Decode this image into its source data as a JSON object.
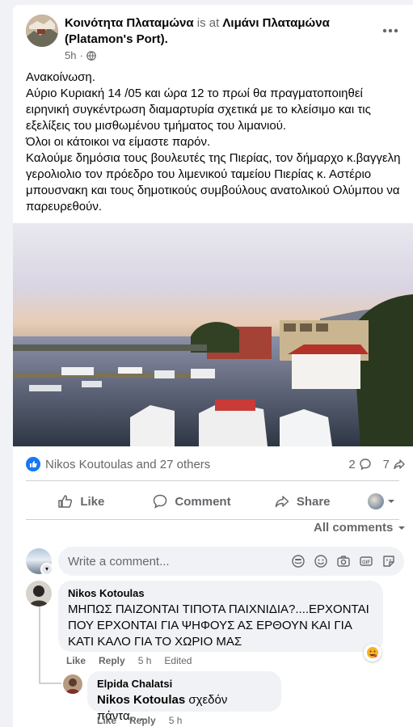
{
  "post": {
    "page_name": "Κοινότητα Πλαταμώνα",
    "is_at": "is at",
    "location": "Λιμάνι Πλαταμώνα",
    "location_en": "(Platamon's Port).",
    "time": "5h",
    "text": "Ανακοίνωση.\nΑύριο Κυριακή 14 /05 και ώρα 12 το πρωί θα πραγματοποιηθεί ειρηνική συγκέντρωση διαμαρτυρία σχετικά με το κλείσιμο και τις εξελίξεις του μισθωμένου τμήματος του λιμανιού.\nΌλοι οι κάτοικοι να είμαστε παρόν.\nΚαλούμε δημόσια τους βουλευτές της Πιερίας, τον δήμαρχο κ.βαγγελη γερολιολιο τον πρόεδρο του λιμενικού ταμείου Πιερίας κ. Αστέριο μπουσνακη και τους δημοτικούς συμβούλους ανατολικού Ολύμπου να παρευρεθούν."
  },
  "reactions": {
    "summary": "Nikos Koutoulas and 27 others",
    "comments_count": "2",
    "shares_count": "7"
  },
  "actions": {
    "like": "Like",
    "comment": "Comment",
    "share": "Share"
  },
  "filter": {
    "label": "All comments"
  },
  "composer": {
    "placeholder": "Write a comment..."
  },
  "comments": [
    {
      "author": "Nikos Kotoulas",
      "text": "ΜΗΠΩΣ ΠΑΙΖΟΝΤΑΙ ΤΙΠΟΤΑ ΠΑΙΧΝΙΔΙΑ?....ΕΡΧΟΝΤΑΙ ΠΟΥ ΕΡΧΟΝΤΑΙ ΓΙΑ ΨΗΦΟΥΣ ΑΣ ΕΡΘΟΥΝ ΚΑΙ ΓΙΑ ΚΑΤΙ ΚΑΛΟ ΓΙΑ ΤΟ ΧΩΡΙΟ ΜΑΣ",
      "like": "Like",
      "reply": "Reply",
      "time": "5 h",
      "edited": "Edited"
    },
    {
      "author": "Elpida Chalatsi",
      "mention": "Nikos Kotoulas",
      "text": " σχεδόν πάντα.....",
      "like": "Like",
      "reply": "Reply",
      "time": "5 h"
    }
  ],
  "colors": {
    "accent": "#1877f2",
    "muted_text": "#65676b",
    "bubble_bg": "#f0f2f5"
  }
}
